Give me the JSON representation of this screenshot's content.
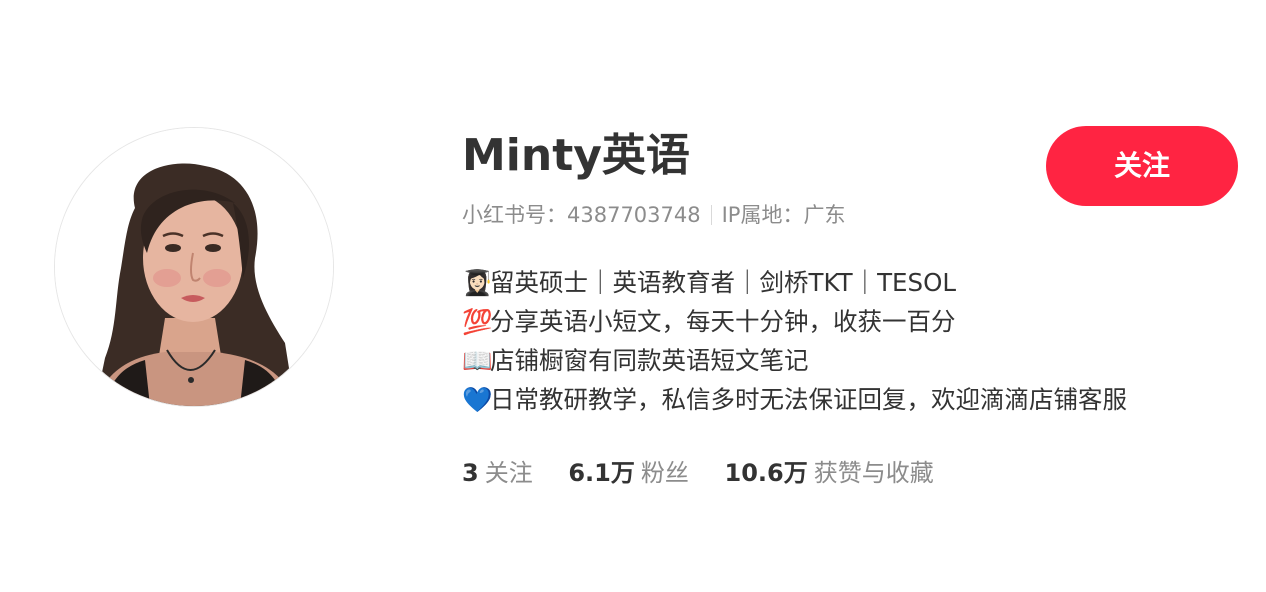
{
  "profile": {
    "name": "Minty英语",
    "id_label": "小红书号：4387703748",
    "ip_label": "IP属地：广东",
    "follow_button": "关注",
    "accent_color": "#ff2442"
  },
  "bio": [
    {
      "emoji": "👩🏻‍🎓",
      "emoji_name": "graduate-emoji",
      "text": "留英硕士｜英语教育者｜剑桥TKT｜TESOL"
    },
    {
      "emoji": "💯",
      "emoji_name": "hundred-points-emoji",
      "text": "分享英语小短文，每天十分钟，收获一百分"
    },
    {
      "emoji": "📖",
      "emoji_name": "open-book-emoji",
      "text": "店铺橱窗有同款英语短文笔记"
    },
    {
      "emoji": "💙",
      "emoji_name": "blue-heart-emoji",
      "text": "日常教研教学，私信多时无法保证回复，欢迎滴滴店铺客服"
    }
  ],
  "stats": [
    {
      "value": "3",
      "label": "关注"
    },
    {
      "value": "6.1万",
      "label": "粉丝"
    },
    {
      "value": "10.6万",
      "label": "获赞与收藏"
    }
  ]
}
